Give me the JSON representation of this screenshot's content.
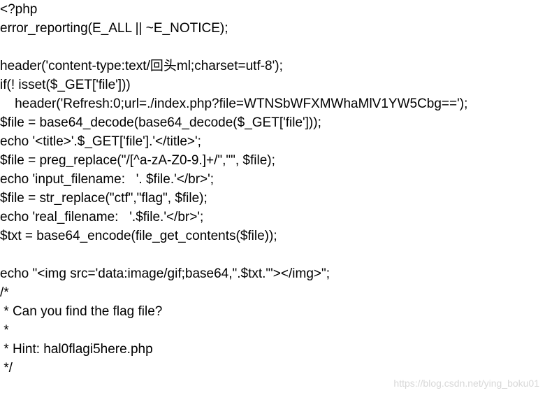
{
  "code_lines": [
    "<?php",
    "error_reporting(E_ALL || ~E_NOTICE);",
    "",
    "header('content-type:text/回头ml;charset=utf-8');",
    "if(! isset($_GET['file']))",
    "    header('Refresh:0;url=./index.php?file=WTNSbWFXMWhaMlV1YW5Cbg==');",
    "$file = base64_decode(base64_decode($_GET['file']));",
    "echo '<title>'.$_GET['file'].'</title>';",
    "$file = preg_replace(\"/[^a-zA-Z0-9.]+/\",\"\", $file);",
    "echo 'input_filename:   '. $file.'</br>';",
    "$file = str_replace(\"ctf\",\"flag\", $file);",
    "echo 'real_filename:   '.$file.'</br>';",
    "$txt = base64_encode(file_get_contents($file));",
    "",
    "echo \"<img src='data:image/gif;base64,\".$txt.\"'></img>\";",
    "/*",
    " * Can you find the flag file?",
    " *",
    " * Hint: hal0flagi5here.php",
    " */"
  ],
  "watermark": "https://blog.csdn.net/ying_boku01"
}
